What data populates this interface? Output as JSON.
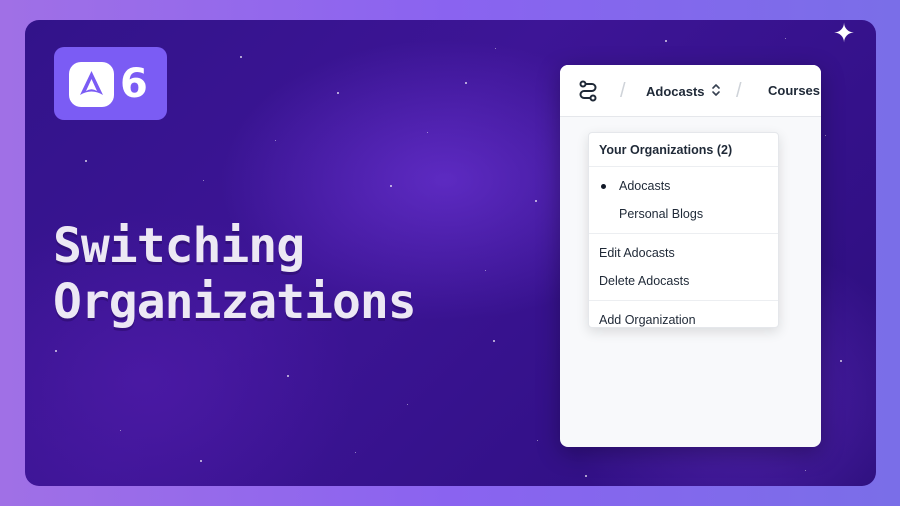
{
  "brand": {
    "badge_number": "6",
    "logo_icon": "adonis-a-icon"
  },
  "headline": {
    "line1": "Switching",
    "line2": "Organizations"
  },
  "app": {
    "nav_icon": "route-icon",
    "org_switcher_label": "Adocasts",
    "org_switcher_icon": "chevron-up-down-icon",
    "courses_link": "Courses"
  },
  "dropdown": {
    "header": "Your Organizations (2)",
    "organizations": [
      {
        "label": "Adocasts",
        "selected": true
      },
      {
        "label": "Personal Blogs",
        "selected": false
      }
    ],
    "edit_label": "Edit Adocasts",
    "delete_label": "Delete Adocasts",
    "add_label": "Add Organization"
  },
  "colors": {
    "background": "#3d1596",
    "badge": "#7b5cf4",
    "headline_text": "#ece8f4"
  }
}
